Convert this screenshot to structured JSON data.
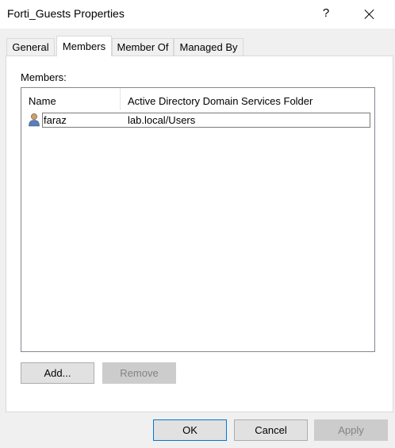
{
  "window": {
    "title": "Forti_Guests Properties",
    "help_label": "?"
  },
  "tabs": [
    {
      "label": "General"
    },
    {
      "label": "Members",
      "selected": true
    },
    {
      "label": "Member Of"
    },
    {
      "label": "Managed By"
    }
  ],
  "members": {
    "label": "Members:",
    "columns": [
      "Name",
      "Active Directory Domain Services Folder"
    ],
    "rows": [
      {
        "name": "faraz",
        "folder": "lab.local/Users",
        "icon": "user-icon"
      }
    ],
    "add_label": "Add...",
    "remove_label": "Remove"
  },
  "footer": {
    "ok_label": "OK",
    "cancel_label": "Cancel",
    "apply_label": "Apply"
  },
  "colors": {
    "accent": "#0078d7",
    "disabled_button": "#cccccc"
  }
}
